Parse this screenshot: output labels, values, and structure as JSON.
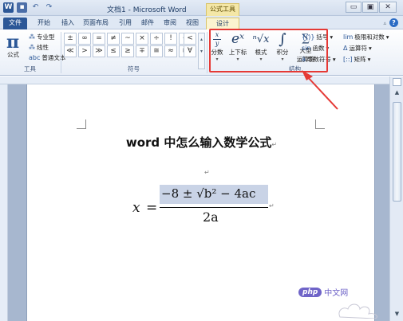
{
  "window": {
    "title": "文档1 - Microsoft Word",
    "context_group": "公式工具",
    "min_symbol": "▭",
    "restore_symbol": "▣",
    "close_symbol": "✕"
  },
  "qat": {
    "word_icon": "W",
    "save_icon": "save-icon",
    "undo": "↶",
    "redo": "↷"
  },
  "tabs": [
    "文件",
    "开始",
    "插入",
    "页面布局",
    "引用",
    "邮件",
    "审阅",
    "视图",
    "设计"
  ],
  "ribbon": {
    "tools": {
      "formula_glyph": "π",
      "formula_label": "公式",
      "options": [
        "专业型",
        "线性",
        "普通文本"
      ],
      "option_icons": [
        "⁂",
        "⁂",
        "abc"
      ],
      "group_label": "工具"
    },
    "symbols": {
      "row1": [
        "±",
        "∞",
        "=",
        "≠",
        "~",
        "×",
        "÷",
        "!",
        "∝",
        "<"
      ],
      "row2": [
        "≪",
        ">",
        "≫",
        "≤",
        "≥",
        "∓",
        "≅",
        "≈",
        "≡",
        "∀"
      ],
      "group_label": "符号"
    },
    "structures": {
      "items": [
        {
          "glyph_top": "x",
          "glyph_bottom": "y",
          "label": "分数"
        },
        {
          "glyph": "eˣ",
          "label": "上下标"
        },
        {
          "glyph": "ⁿ√x",
          "label": "根式"
        },
        {
          "glyph": "∫",
          "label": "积分"
        },
        {
          "glyph": "∑",
          "label": "大型",
          "label2": "运算符"
        }
      ],
      "right": [
        "括号",
        "函数",
        "导数符号",
        "极限和对数",
        "运算符",
        "矩阵"
      ],
      "right_icons": [
        "{()}",
        "sin",
        "ä",
        "lim",
        "Δ",
        "[::]"
      ],
      "group_label": "结构"
    }
  },
  "document": {
    "title": "word 中怎么输入数学公式",
    "para_mark": "↵",
    "equation": {
      "lhs": "x",
      "equals": "=",
      "numerator": "−8 ± √b² − 4ac",
      "denominator": "2a"
    }
  },
  "watermark": {
    "logo": "php",
    "text": "中文网"
  }
}
